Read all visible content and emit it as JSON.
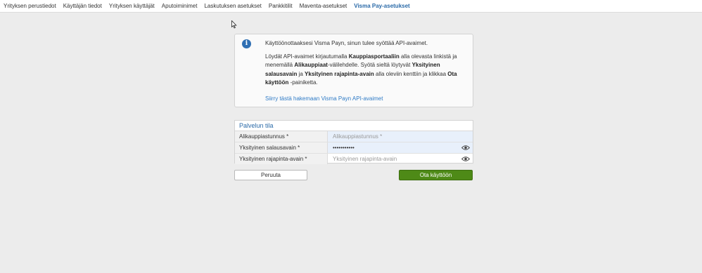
{
  "nav": {
    "tabs": [
      {
        "label": "Yrityksen perustiedot"
      },
      {
        "label": "Käyttäjän tiedot"
      },
      {
        "label": "Yrityksen käyttäjät"
      },
      {
        "label": "Aputoiminimet"
      },
      {
        "label": "Laskutuksen asetukset"
      },
      {
        "label": "Pankkitilit"
      },
      {
        "label": "Maventa-asetukset"
      },
      {
        "label": "Visma Pay-asetukset",
        "active": true
      }
    ]
  },
  "info": {
    "icon": "info-icon",
    "line1": "Käyttöönottaaksesi Visma Payn, sinun tulee syöttää API-avaimet.",
    "p2": {
      "t1": "Löydät API-avaimet kirjautumalla ",
      "b1": "Kauppiasportaaliin",
      "t2": " alla olevasta linkistä ja menemällä ",
      "b2": "Alikauppiaat",
      "t3": "-välilehdelle. Syötä sieltä löytyvät ",
      "b3": "Yksityinen salausavain",
      "t4": " ja ",
      "b4": "Yksityinen rajapinta-avain",
      "t5": " alla oleviin kenttiin ja klikkaa ",
      "b5": "Ota käyttöön",
      "t6": " -painiketta."
    },
    "link": "Siirry tästä hakemaan Visma Payn API-avaimet"
  },
  "panel": {
    "title": "Palvelun tila",
    "fields": [
      {
        "label": "Alikauppiastunnus *",
        "value": "",
        "placeholder": "Alikauppiastunnus *"
      },
      {
        "label": "Yksityinen salausavain *",
        "value": "•••••••••••",
        "placeholder": ""
      },
      {
        "label": "Yksityinen rajapinta-avain *",
        "value": "",
        "placeholder": "Yksityinen rajapinta-avain"
      }
    ]
  },
  "buttons": {
    "cancel": "Peruuta",
    "enable": "Ota käyttöön"
  },
  "colors": {
    "accent": "#2a6aa8",
    "link": "#2f7bc6",
    "primary_button": "#4e8a17",
    "background": "#ececec"
  }
}
